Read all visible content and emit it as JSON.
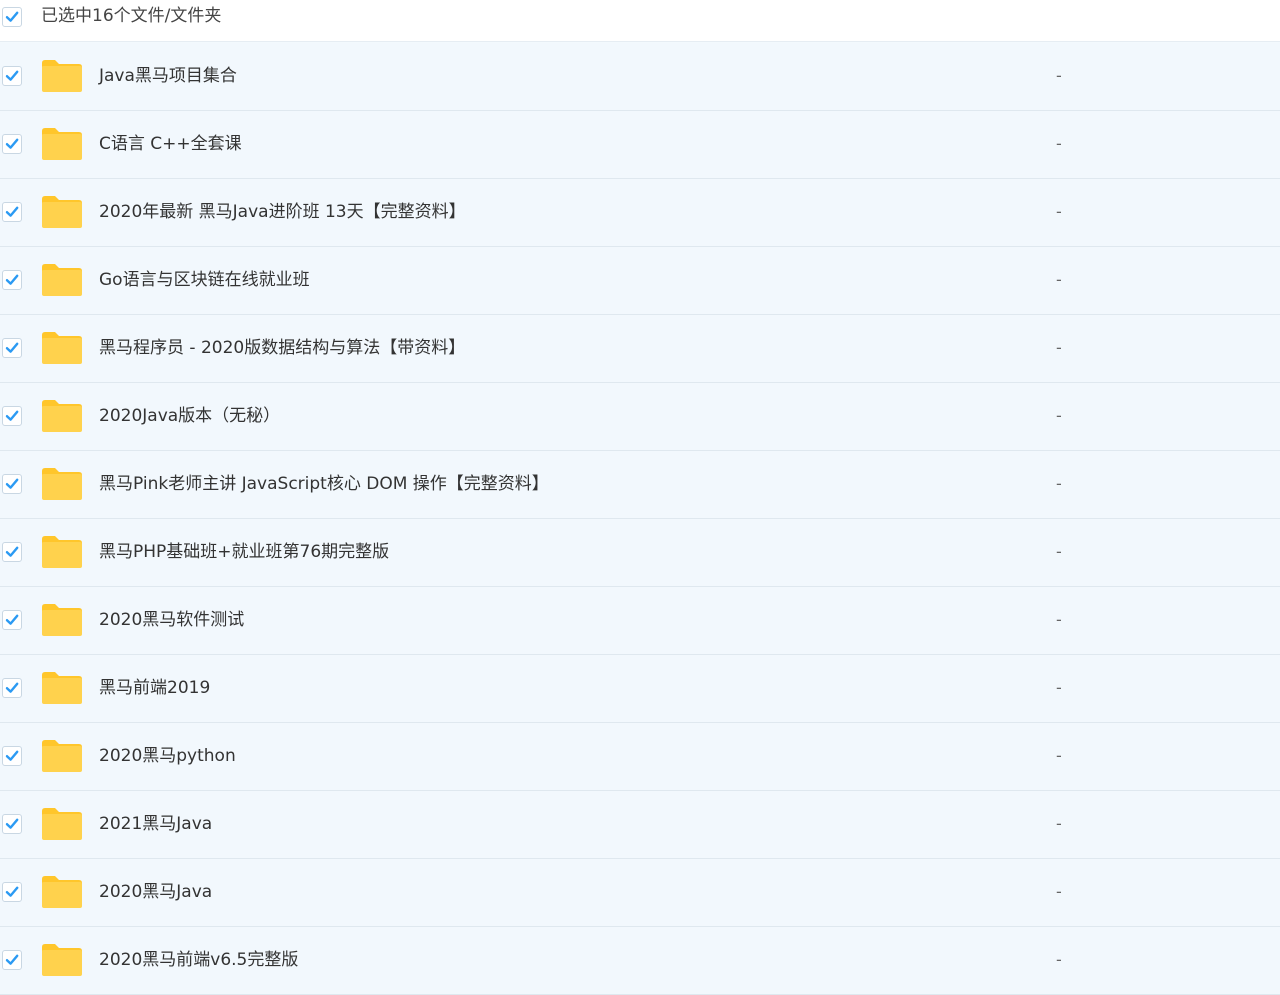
{
  "header": {
    "selection_text": "已选中16个文件/文件夹"
  },
  "items": [
    {
      "name": "Java黑马项目集合",
      "size": "-"
    },
    {
      "name": "C语言 C++全套课",
      "size": "-"
    },
    {
      "name": "2020年最新 黑马Java进阶班 13天【完整资料】",
      "size": "-"
    },
    {
      "name": "Go语言与区块链在线就业班",
      "size": "-"
    },
    {
      "name": "黑马程序员 - 2020版数据结构与算法【带资料】",
      "size": "-"
    },
    {
      "name": "2020Java版本（无秘）",
      "size": "-"
    },
    {
      "name": "黑马Pink老师主讲 JavaScript核心 DOM 操作【完整资料】",
      "size": "-"
    },
    {
      "name": "黑马PHP基础班+就业班第76期完整版",
      "size": "-"
    },
    {
      "name": "2020黑马软件测试",
      "size": "-"
    },
    {
      "name": "黑马前端2019",
      "size": "-"
    },
    {
      "name": "2020黑马python",
      "size": "-"
    },
    {
      "name": "2021黑马Java",
      "size": "-"
    },
    {
      "name": "2020黑马Java",
      "size": "-"
    },
    {
      "name": "2020黑马前端v6.5完整版",
      "size": "-"
    }
  ],
  "colors": {
    "check": "#2b9af3",
    "folder": "#ffd24d",
    "folder_tab": "#ffc62b",
    "row_bg": "#f2f8fd",
    "divider": "#dfe8ef"
  },
  "icons": {
    "checkbox": "checkbox-checked-icon",
    "folder": "folder-icon"
  }
}
